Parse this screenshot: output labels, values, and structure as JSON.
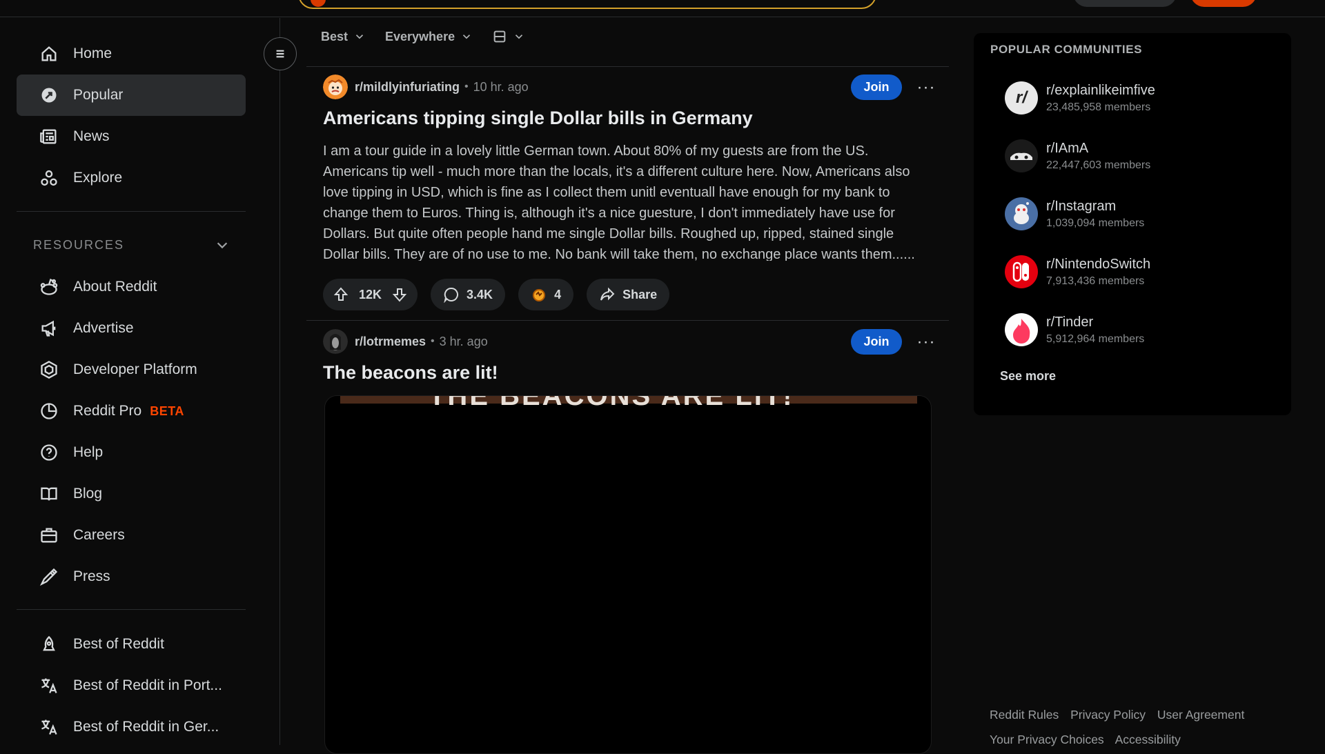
{
  "sidebar": {
    "nav": [
      {
        "label": "Home",
        "icon": "home-icon"
      },
      {
        "label": "Popular",
        "icon": "popular-icon",
        "active": true
      },
      {
        "label": "News",
        "icon": "news-icon"
      },
      {
        "label": "Explore",
        "icon": "explore-icon"
      }
    ],
    "resources_title": "RESOURCES",
    "resources": [
      {
        "label": "About Reddit",
        "icon": "reddit-alien-icon"
      },
      {
        "label": "Advertise",
        "icon": "megaphone-icon"
      },
      {
        "label": "Developer Platform",
        "icon": "developer-platform-icon"
      },
      {
        "label": "Reddit Pro",
        "icon": "pie-chart-icon",
        "badge": "BETA"
      },
      {
        "label": "Help",
        "icon": "help-icon"
      },
      {
        "label": "Blog",
        "icon": "book-icon"
      },
      {
        "label": "Careers",
        "icon": "briefcase-icon"
      },
      {
        "label": "Press",
        "icon": "pen-icon"
      }
    ],
    "extra": [
      {
        "label": "Best of Reddit",
        "icon": "best-of-reddit-icon"
      },
      {
        "label": "Best of Reddit in Port...",
        "icon": "translate-icon"
      },
      {
        "label": "Best of Reddit in Ger...",
        "icon": "translate-icon"
      }
    ]
  },
  "feed": {
    "sort": "Best",
    "location": "Everywhere",
    "view_icon": "card-view-icon"
  },
  "posts": [
    {
      "subreddit": "r/mildlyinfuriating",
      "time": "10 hr. ago",
      "join": "Join",
      "title": "Americans tipping single Dollar bills in Germany",
      "body": "I am a tour guide in a lovely little German town. About 80% of my guests are from the US. Americans tip well - much more than the locals, it's a different culture here. Now, Americans also love tipping in USD, which is fine as I collect them unitl eventuall have enough for my bank to change them to Euros. Thing is, although it's a nice guesture, I don't immediately have use for Dollars. But quite often people hand me single Dollar bills. Roughed up, ripped, stained single Dollar bills. They are of no use to me. No bank will take them, no exchange place wants them......",
      "votes": "12K",
      "comments": "3.4K",
      "awards": "4",
      "share": "Share"
    },
    {
      "subreddit": "r/lotrmemes",
      "time": "3 hr. ago",
      "join": "Join",
      "title": "The beacons are lit!",
      "media_text": "THE BEACONS ARE LIT!"
    }
  ],
  "popular_communities": {
    "title": "POPULAR COMMUNITIES",
    "items": [
      {
        "name": "r/explainlikeimfive",
        "members": "23,485,958 members",
        "color": "#e8e8e8"
      },
      {
        "name": "r/IAmA",
        "members": "22,447,603 members",
        "color": "#1a1a1a"
      },
      {
        "name": "r/Instagram",
        "members": "1,039,094 members",
        "color": "#4a6fa5"
      },
      {
        "name": "r/NintendoSwitch",
        "members": "7,913,436 members",
        "color": "#e4000f"
      },
      {
        "name": "r/Tinder",
        "members": "5,912,964 members",
        "color": "#fd3a5f"
      }
    ],
    "see_more": "See more"
  },
  "footer": {
    "links": [
      "Reddit Rules",
      "Privacy Policy",
      "User Agreement",
      "Your Privacy Choices",
      "Accessibility"
    ]
  },
  "colors": {
    "accent": "#ff4500",
    "join_button": "#115bca",
    "search_border": "#d4a12a"
  }
}
